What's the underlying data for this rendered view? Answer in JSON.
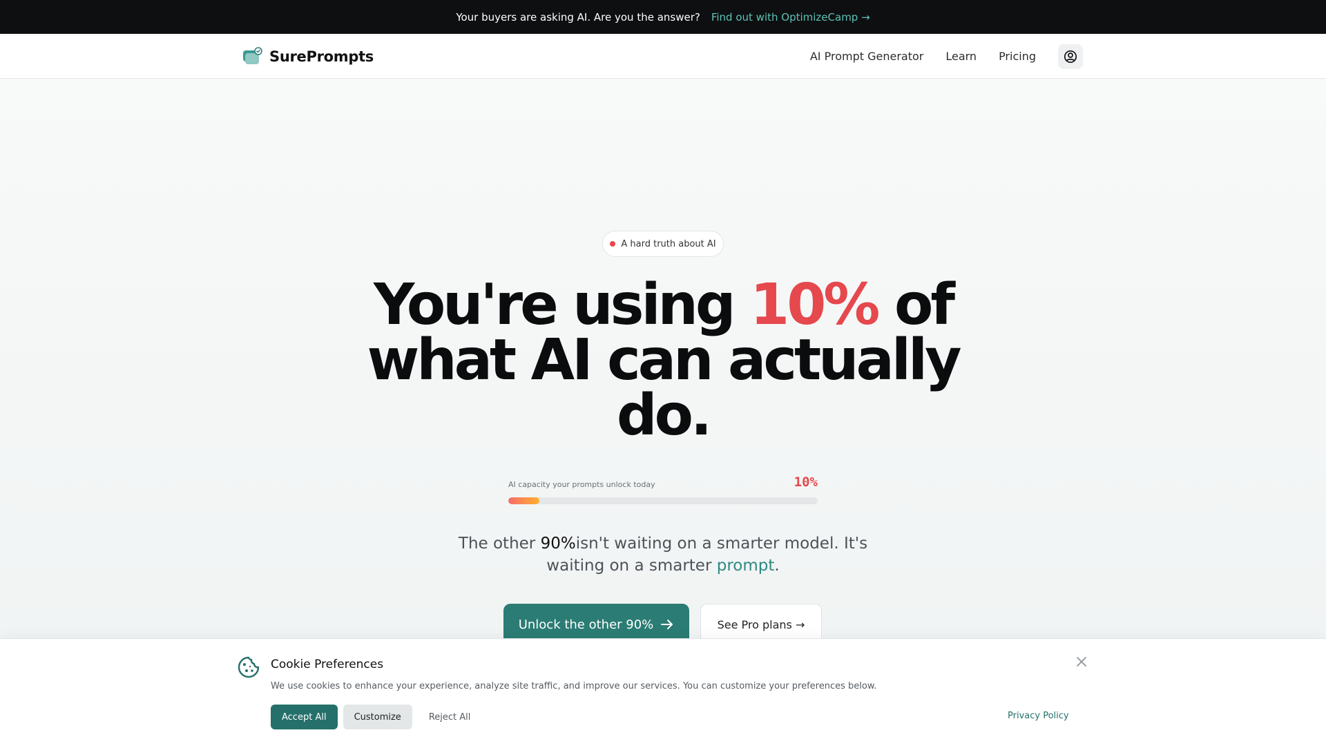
{
  "announcement": {
    "message": "Your buyers are asking AI. Are you the answer?",
    "link_label": "Find out with OptimizeCamp →"
  },
  "nav": {
    "brand": "SurePrompts",
    "links": [
      "AI Prompt Generator",
      "Learn",
      "Pricing"
    ],
    "account_icon": "user-circle-icon"
  },
  "hero": {
    "pill_label": "A hard truth about AI",
    "headline": {
      "before": "You're using ",
      "accent": "10%",
      "after": " of what AI can actually do."
    },
    "meter": {
      "label": "AI capacity your prompts unlock today",
      "value_label": "10%",
      "fraction": 0.1
    },
    "subcopy": {
      "part1": "The other ",
      "strong": "90%",
      "part2": "isn't waiting on a smarter model. It's waiting on a smarter ",
      "accent": "prompt",
      "part3": "."
    },
    "cta_primary": "Unlock the other 90%",
    "cta_secondary": "See Pro plans →"
  },
  "cookie": {
    "title": "Cookie Preferences",
    "description": "We use cookies to enhance your experience, analyze site traffic, and improve our services. You can customize your preferences below.",
    "accept": "Accept All",
    "customize": "Customize",
    "reject": "Reject All",
    "privacy": "Privacy Policy"
  },
  "colors": {
    "brand_teal": "#2b7c74",
    "accent_red": "#e5484d",
    "announce_bg": "#0e0f10"
  }
}
